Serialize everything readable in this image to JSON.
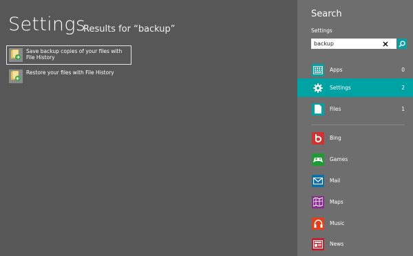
{
  "results_panel": {
    "title": "Settings",
    "subtitle": "Results for “backup”",
    "items": [
      {
        "label": "Save backup copies of your files with File History",
        "selected": true
      },
      {
        "label": "Restore your files with File History",
        "selected": false
      }
    ]
  },
  "charm": {
    "title": "Search",
    "scope_label": "Settings",
    "search": {
      "value": "backup"
    },
    "categories": [
      {
        "label": "Apps",
        "count": "0",
        "icon": "apps-icon",
        "color": "#00a2a4"
      },
      {
        "label": "Settings",
        "count": "2",
        "icon": "gear-icon",
        "color": "#00a2a4"
      },
      {
        "label": "Files",
        "count": "1",
        "icon": "file-icon",
        "color": "#00a2a4"
      }
    ],
    "apps": [
      {
        "label": "Bing",
        "icon": "bing-icon",
        "color": "#d0322f"
      },
      {
        "label": "Games",
        "icon": "gamepad-icon",
        "color": "#1e9b32"
      },
      {
        "label": "Mail",
        "icon": "mail-icon",
        "color": "#0f70a8"
      },
      {
        "label": "Maps",
        "icon": "map-icon",
        "color": "#8a2f8f"
      },
      {
        "label": "Music",
        "icon": "headphones-icon",
        "color": "#e0401c"
      },
      {
        "label": "News",
        "icon": "news-icon",
        "color": "#c4212f"
      }
    ]
  }
}
